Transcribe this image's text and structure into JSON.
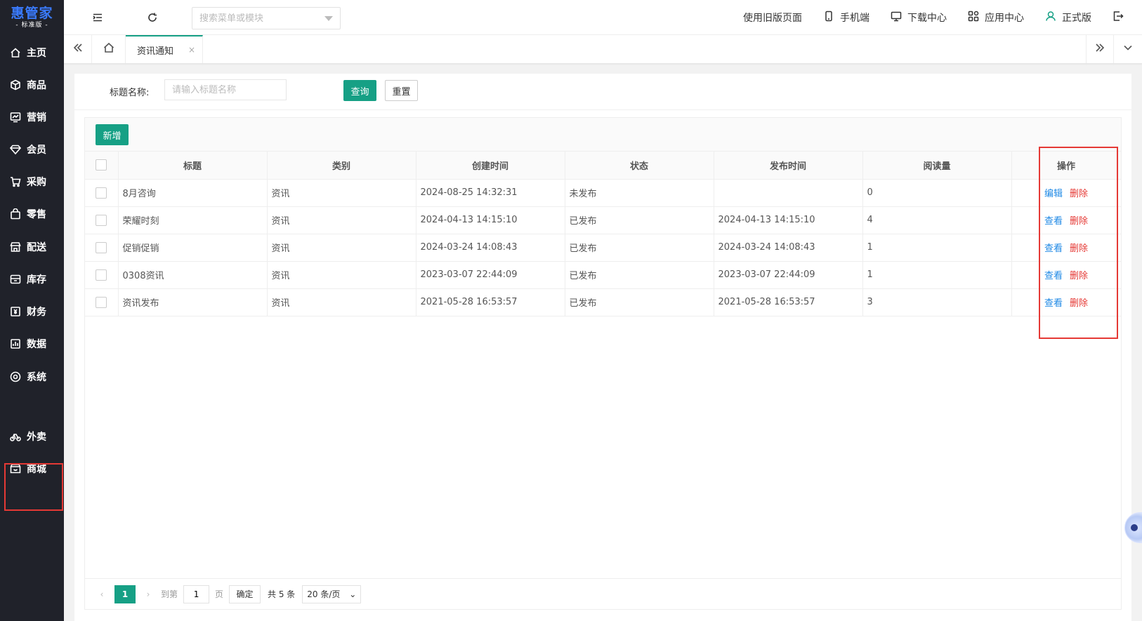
{
  "logo": {
    "main": "惠管家",
    "sub": "- 标准版 -"
  },
  "sidebar": {
    "items": [
      {
        "label": "主页",
        "icon": "home-icon"
      },
      {
        "label": "商品",
        "icon": "cube-icon"
      },
      {
        "label": "营销",
        "icon": "chart-screen-icon"
      },
      {
        "label": "会员",
        "icon": "diamond-icon"
      },
      {
        "label": "采购",
        "icon": "cart-icon"
      },
      {
        "label": "零售",
        "icon": "bag-icon"
      },
      {
        "label": "配送",
        "icon": "store-icon"
      },
      {
        "label": "库存",
        "icon": "box-icon"
      },
      {
        "label": "财务",
        "icon": "money-icon"
      },
      {
        "label": "数据",
        "icon": "bar-chart-icon"
      },
      {
        "label": "系统",
        "icon": "settings-icon"
      },
      {
        "label": "外卖",
        "icon": "bike-icon"
      },
      {
        "label": "商城",
        "icon": "mall-icon"
      }
    ]
  },
  "topbar": {
    "search_placeholder": "搜索菜单或模块",
    "links": [
      {
        "label": "使用旧版页面",
        "icon": ""
      },
      {
        "label": "手机端",
        "icon": "phone-icon"
      },
      {
        "label": "下载中心",
        "icon": "monitor-icon"
      },
      {
        "label": "应用中心",
        "icon": "apps-icon"
      },
      {
        "label": "正式版",
        "icon": "user-icon"
      }
    ]
  },
  "tabs": {
    "active": "资讯通知",
    "close": "×"
  },
  "filter": {
    "label": "标题名称:",
    "placeholder": "请输入标题名称",
    "query": "查询",
    "reset": "重置"
  },
  "toolbar": {
    "add": "新增"
  },
  "table": {
    "columns": [
      "标题",
      "类别",
      "创建时间",
      "状态",
      "发布时间",
      "阅读量",
      "操作"
    ],
    "rows": [
      {
        "title": "8月咨询",
        "category": "资讯",
        "created": "2024-08-25 14:32:31",
        "status": "未发布",
        "published": "",
        "reads": "0",
        "action1": "编辑",
        "action2": "删除"
      },
      {
        "title": "荣耀时刻",
        "category": "资讯",
        "created": "2024-04-13 14:15:10",
        "status": "已发布",
        "published": "2024-04-13 14:15:10",
        "reads": "4",
        "action1": "查看",
        "action2": "删除"
      },
      {
        "title": "促销促销",
        "category": "资讯",
        "created": "2024-03-24 14:08:43",
        "status": "已发布",
        "published": "2024-03-24 14:08:43",
        "reads": "1",
        "action1": "查看",
        "action2": "删除"
      },
      {
        "title": "0308资讯",
        "category": "资讯",
        "created": "2023-03-07 22:44:09",
        "status": "已发布",
        "published": "2023-03-07 22:44:09",
        "reads": "1",
        "action1": "查看",
        "action2": "删除"
      },
      {
        "title": "资讯发布",
        "category": "资讯",
        "created": "2021-05-28 16:53:57",
        "status": "已发布",
        "published": "2021-05-28 16:53:57",
        "reads": "3",
        "action1": "查看",
        "action2": "删除"
      }
    ]
  },
  "pager": {
    "current": "1",
    "goto_label": "到第",
    "page_value": "1",
    "page_unit": "页",
    "confirm": "确定",
    "total": "共 5 条",
    "size": "20 条/页"
  },
  "colors": {
    "accent": "#16a085",
    "sidebar": "#20222a",
    "danger": "#e53935",
    "link": "#1e88e5"
  }
}
